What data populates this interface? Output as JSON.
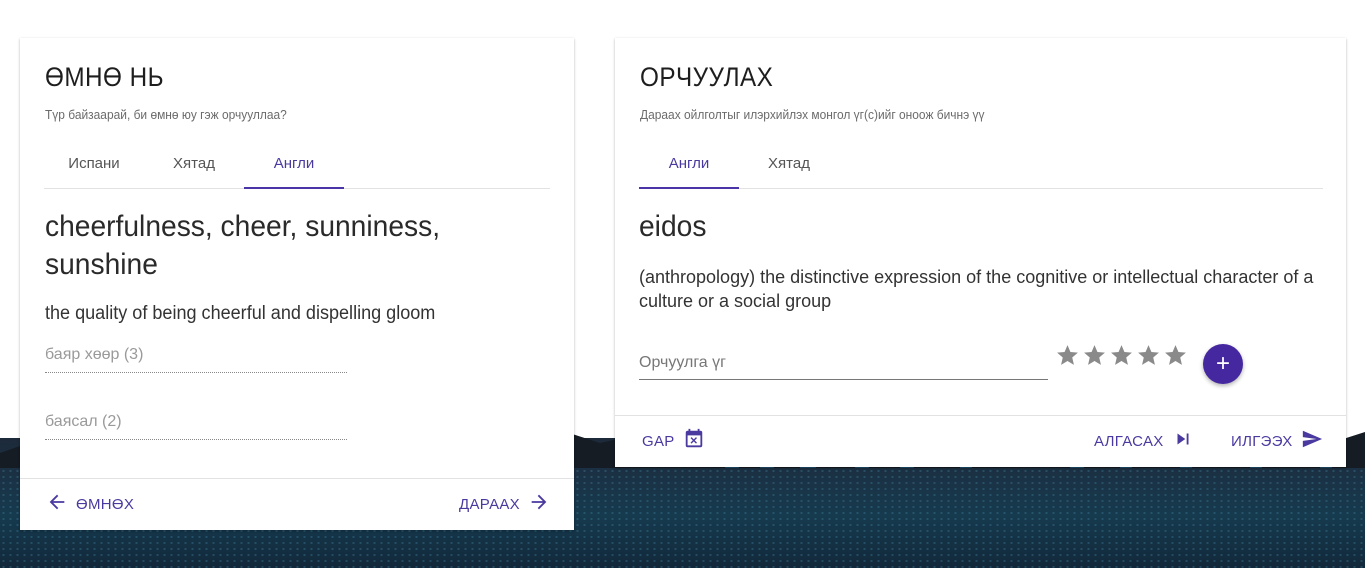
{
  "left": {
    "title": "ӨМНӨ НЬ",
    "subtitle": "Түр байзаарай, би өмнө юу гэж орчууллаа?",
    "tabs": [
      "Испани",
      "Хятад",
      "Англи"
    ],
    "active_tab": 2,
    "word": "cheerfulness, cheer, sunniness, sunshine",
    "definition": "the quality of being cheerful and dispelling gloom",
    "suggestions": [
      "баяр хөөр (3)",
      "баясал (2)"
    ],
    "footer": {
      "prev_label": "ӨМНӨХ",
      "next_label": "ДАРААХ"
    }
  },
  "right": {
    "title": "ОРЧУУЛАХ",
    "subtitle": "Дараах ойлголтыг илэрхийлэх монгол үг(с)ийг оноож бичнэ үү",
    "tabs": [
      "Англи",
      "Хятад"
    ],
    "active_tab": 0,
    "word": "eidos",
    "definition": "(anthropology) the distinctive expression of the cognitive or intellectual character of a culture or a social group",
    "input_placeholder": "Орчуулга үг",
    "input_value": "",
    "rating": {
      "max": 5,
      "value": 0
    },
    "add_label": "+",
    "footer": {
      "gap_label": "GAP",
      "skip_label": "АЛГАСАХ",
      "send_label": "ИЛГЭЭХ"
    }
  },
  "colors": {
    "accent": "#4a34a8",
    "fab": "#4527a0",
    "star": "#8a8a8a"
  },
  "icons": {
    "prev": "arrow-left-icon",
    "next": "arrow-right-icon",
    "gap": "calendar-remove-icon",
    "skip": "skip-next-icon",
    "send": "send-icon",
    "star": "star-icon"
  }
}
